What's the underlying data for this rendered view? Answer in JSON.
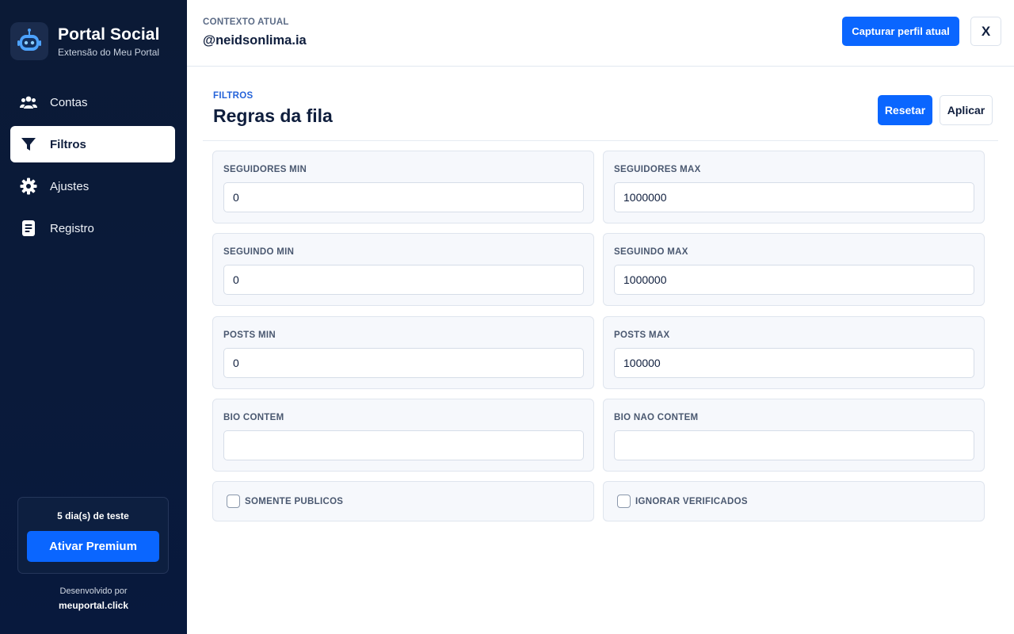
{
  "app": {
    "title": "Portal Social",
    "subtitle": "Extensão do Meu Portal",
    "logo_icon": "robot-icon"
  },
  "sidebar": {
    "items": [
      {
        "label": "Contas",
        "icon": "users-icon",
        "active": false
      },
      {
        "label": "Filtros",
        "icon": "filter-icon",
        "active": true
      },
      {
        "label": "Ajustes",
        "icon": "gear-icon",
        "active": false
      },
      {
        "label": "Registro",
        "icon": "document-icon",
        "active": false
      }
    ],
    "trial_text": "5 dia(s) de teste",
    "premium_label": "Ativar Premium",
    "developed_by": "Desenvolvido por",
    "developer_site": "meuportal.click"
  },
  "header": {
    "context_label": "CONTEXTO ATUAL",
    "context_user": "@neidsonlima.ia",
    "capture_label": "Capturar perfil atual",
    "close_label": "X"
  },
  "main": {
    "eyebrow": "FILTROS",
    "title": "Regras da fila",
    "reset_label": "Resetar",
    "apply_label": "Aplicar",
    "fields": [
      {
        "label": "SEGUIDORES MIN",
        "value": "0"
      },
      {
        "label": "SEGUIDORES MAX",
        "value": "1000000"
      },
      {
        "label": "SEGUINDO MIN",
        "value": "0"
      },
      {
        "label": "SEGUINDO MAX",
        "value": "1000000"
      },
      {
        "label": "POSTS MIN",
        "value": "0"
      },
      {
        "label": "POSTS MAX",
        "value": "100000"
      },
      {
        "label": "BIO CONTEM",
        "value": ""
      },
      {
        "label": "BIO NAO CONTEM",
        "value": ""
      }
    ],
    "checkboxes": [
      {
        "label": "SOMENTE PUBLICOS",
        "checked": false
      },
      {
        "label": "IGNORAR VERIFICADOS",
        "checked": false
      }
    ]
  },
  "colors": {
    "accent": "#0a66ff",
    "sidebar_bg": "#0b1a36",
    "eyebrow": "#2563d9"
  }
}
